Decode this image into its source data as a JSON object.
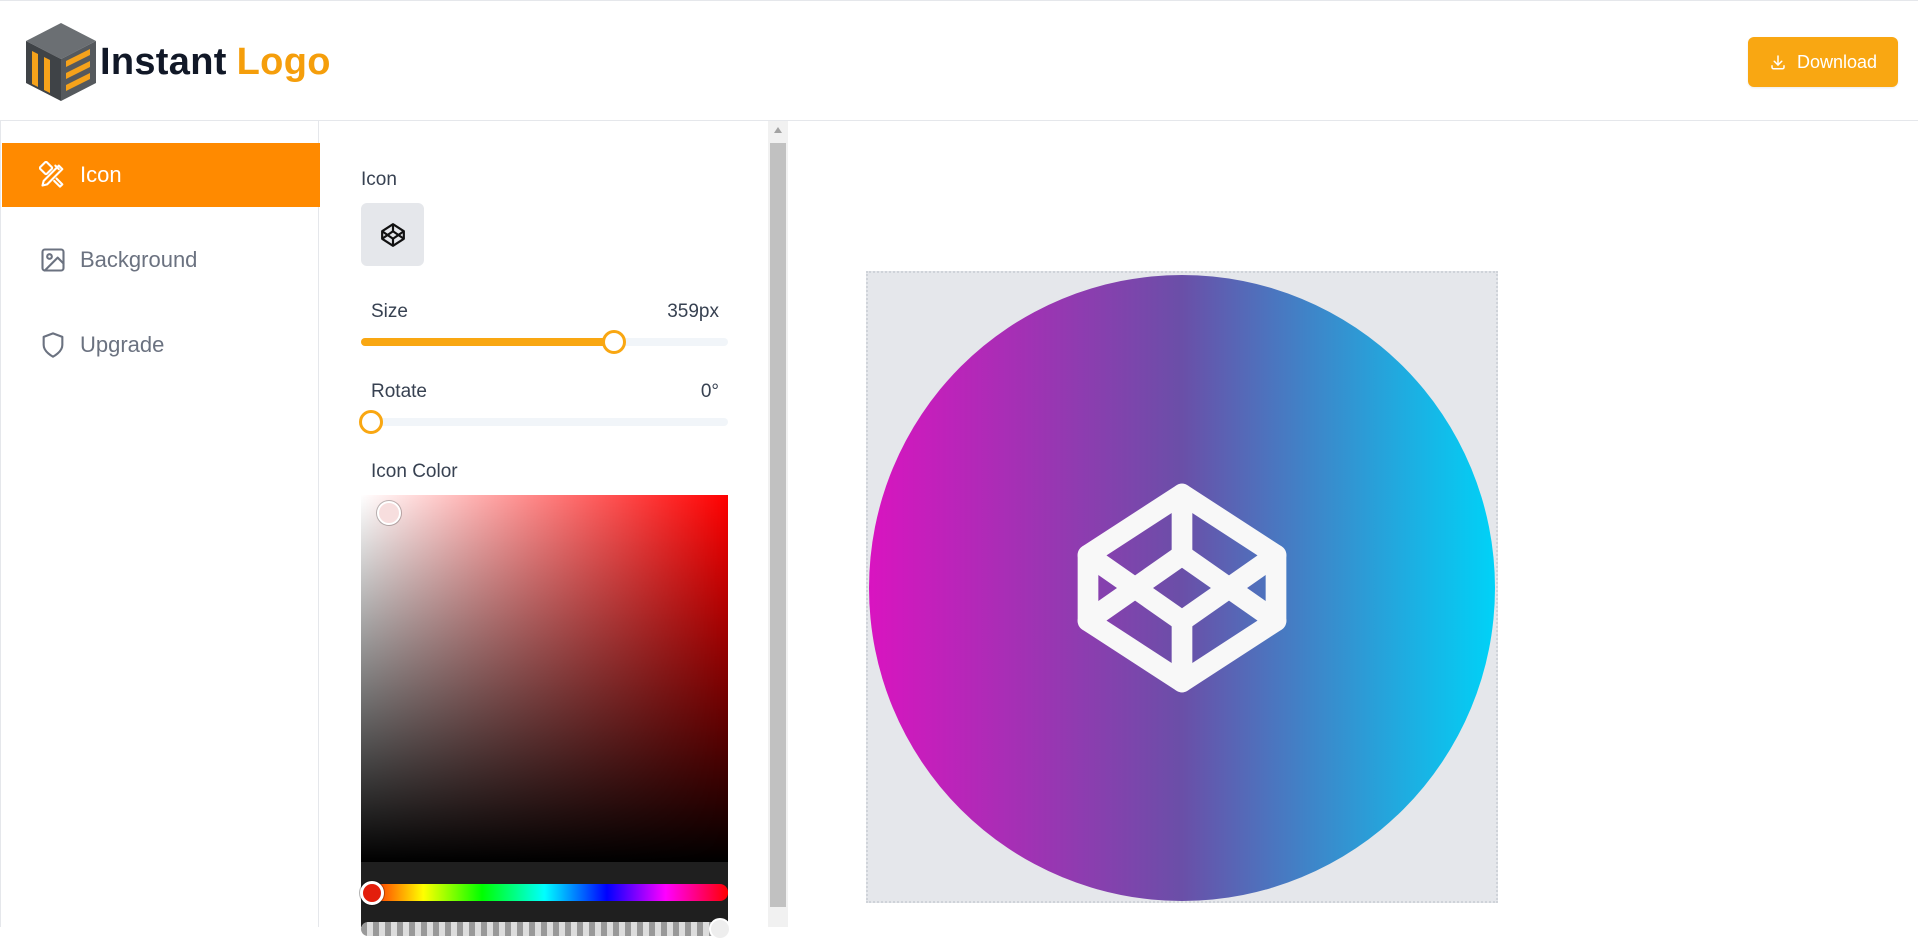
{
  "header": {
    "logo_text_primary": "Instant",
    "logo_text_accent": "Logo",
    "download_label": "Download"
  },
  "sidebar": {
    "items": [
      {
        "label": "Icon",
        "icon": "pencil-ruler-icon",
        "active": true
      },
      {
        "label": "Background",
        "icon": "image-icon",
        "active": false
      },
      {
        "label": "Upgrade",
        "icon": "shield-icon",
        "active": false
      }
    ]
  },
  "panel": {
    "icon_label": "Icon",
    "selected_icon": "codepen-icon",
    "size_label": "Size",
    "size_value": "359px",
    "size_fraction": 0.69,
    "rotate_label": "Rotate",
    "rotate_value": "0°",
    "rotate_fraction": 0.0,
    "icon_color_label": "Icon Color",
    "picker_hue": "#ff0000",
    "selected_color": "#f7f7f7"
  },
  "preview": {
    "gradient_start": "#d914c0",
    "gradient_mid": "#6a4fa8",
    "gradient_end": "#00d2f7",
    "canvas_bg": "#e5e7eb",
    "icon": "codepen-icon",
    "icon_color": "#f8f8f8"
  },
  "colors": {
    "accent": "#ff8a00",
    "button": "#f9a712"
  }
}
